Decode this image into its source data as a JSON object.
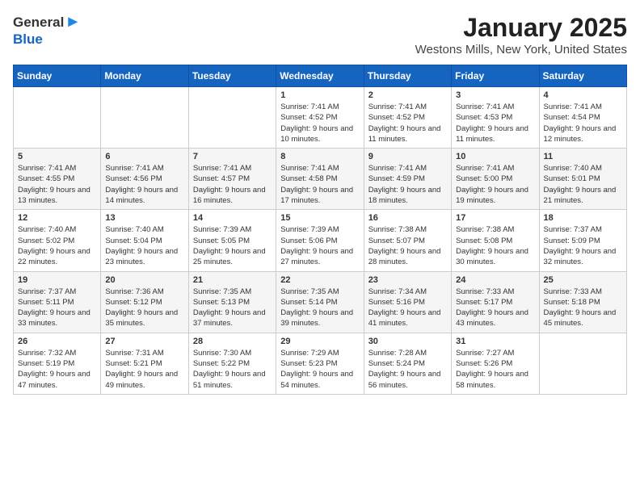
{
  "header": {
    "logo_general": "General",
    "logo_blue": "Blue",
    "title": "January 2025",
    "subtitle": "Westons Mills, New York, United States"
  },
  "calendar": {
    "days_of_week": [
      "Sunday",
      "Monday",
      "Tuesday",
      "Wednesday",
      "Thursday",
      "Friday",
      "Saturday"
    ],
    "weeks": [
      [
        {
          "day": "",
          "info": ""
        },
        {
          "day": "",
          "info": ""
        },
        {
          "day": "",
          "info": ""
        },
        {
          "day": "1",
          "info": "Sunrise: 7:41 AM\nSunset: 4:52 PM\nDaylight: 9 hours\nand 10 minutes."
        },
        {
          "day": "2",
          "info": "Sunrise: 7:41 AM\nSunset: 4:52 PM\nDaylight: 9 hours\nand 11 minutes."
        },
        {
          "day": "3",
          "info": "Sunrise: 7:41 AM\nSunset: 4:53 PM\nDaylight: 9 hours\nand 11 minutes."
        },
        {
          "day": "4",
          "info": "Sunrise: 7:41 AM\nSunset: 4:54 PM\nDaylight: 9 hours\nand 12 minutes."
        }
      ],
      [
        {
          "day": "5",
          "info": "Sunrise: 7:41 AM\nSunset: 4:55 PM\nDaylight: 9 hours\nand 13 minutes."
        },
        {
          "day": "6",
          "info": "Sunrise: 7:41 AM\nSunset: 4:56 PM\nDaylight: 9 hours\nand 14 minutes."
        },
        {
          "day": "7",
          "info": "Sunrise: 7:41 AM\nSunset: 4:57 PM\nDaylight: 9 hours\nand 16 minutes."
        },
        {
          "day": "8",
          "info": "Sunrise: 7:41 AM\nSunset: 4:58 PM\nDaylight: 9 hours\nand 17 minutes."
        },
        {
          "day": "9",
          "info": "Sunrise: 7:41 AM\nSunset: 4:59 PM\nDaylight: 9 hours\nand 18 minutes."
        },
        {
          "day": "10",
          "info": "Sunrise: 7:41 AM\nSunset: 5:00 PM\nDaylight: 9 hours\nand 19 minutes."
        },
        {
          "day": "11",
          "info": "Sunrise: 7:40 AM\nSunset: 5:01 PM\nDaylight: 9 hours\nand 21 minutes."
        }
      ],
      [
        {
          "day": "12",
          "info": "Sunrise: 7:40 AM\nSunset: 5:02 PM\nDaylight: 9 hours\nand 22 minutes."
        },
        {
          "day": "13",
          "info": "Sunrise: 7:40 AM\nSunset: 5:04 PM\nDaylight: 9 hours\nand 23 minutes."
        },
        {
          "day": "14",
          "info": "Sunrise: 7:39 AM\nSunset: 5:05 PM\nDaylight: 9 hours\nand 25 minutes."
        },
        {
          "day": "15",
          "info": "Sunrise: 7:39 AM\nSunset: 5:06 PM\nDaylight: 9 hours\nand 27 minutes."
        },
        {
          "day": "16",
          "info": "Sunrise: 7:38 AM\nSunset: 5:07 PM\nDaylight: 9 hours\nand 28 minutes."
        },
        {
          "day": "17",
          "info": "Sunrise: 7:38 AM\nSunset: 5:08 PM\nDaylight: 9 hours\nand 30 minutes."
        },
        {
          "day": "18",
          "info": "Sunrise: 7:37 AM\nSunset: 5:09 PM\nDaylight: 9 hours\nand 32 minutes."
        }
      ],
      [
        {
          "day": "19",
          "info": "Sunrise: 7:37 AM\nSunset: 5:11 PM\nDaylight: 9 hours\nand 33 minutes."
        },
        {
          "day": "20",
          "info": "Sunrise: 7:36 AM\nSunset: 5:12 PM\nDaylight: 9 hours\nand 35 minutes."
        },
        {
          "day": "21",
          "info": "Sunrise: 7:35 AM\nSunset: 5:13 PM\nDaylight: 9 hours\nand 37 minutes."
        },
        {
          "day": "22",
          "info": "Sunrise: 7:35 AM\nSunset: 5:14 PM\nDaylight: 9 hours\nand 39 minutes."
        },
        {
          "day": "23",
          "info": "Sunrise: 7:34 AM\nSunset: 5:16 PM\nDaylight: 9 hours\nand 41 minutes."
        },
        {
          "day": "24",
          "info": "Sunrise: 7:33 AM\nSunset: 5:17 PM\nDaylight: 9 hours\nand 43 minutes."
        },
        {
          "day": "25",
          "info": "Sunrise: 7:33 AM\nSunset: 5:18 PM\nDaylight: 9 hours\nand 45 minutes."
        }
      ],
      [
        {
          "day": "26",
          "info": "Sunrise: 7:32 AM\nSunset: 5:19 PM\nDaylight: 9 hours\nand 47 minutes."
        },
        {
          "day": "27",
          "info": "Sunrise: 7:31 AM\nSunset: 5:21 PM\nDaylight: 9 hours\nand 49 minutes."
        },
        {
          "day": "28",
          "info": "Sunrise: 7:30 AM\nSunset: 5:22 PM\nDaylight: 9 hours\nand 51 minutes."
        },
        {
          "day": "29",
          "info": "Sunrise: 7:29 AM\nSunset: 5:23 PM\nDaylight: 9 hours\nand 54 minutes."
        },
        {
          "day": "30",
          "info": "Sunrise: 7:28 AM\nSunset: 5:24 PM\nDaylight: 9 hours\nand 56 minutes."
        },
        {
          "day": "31",
          "info": "Sunrise: 7:27 AM\nSunset: 5:26 PM\nDaylight: 9 hours\nand 58 minutes."
        },
        {
          "day": "",
          "info": ""
        }
      ]
    ]
  }
}
